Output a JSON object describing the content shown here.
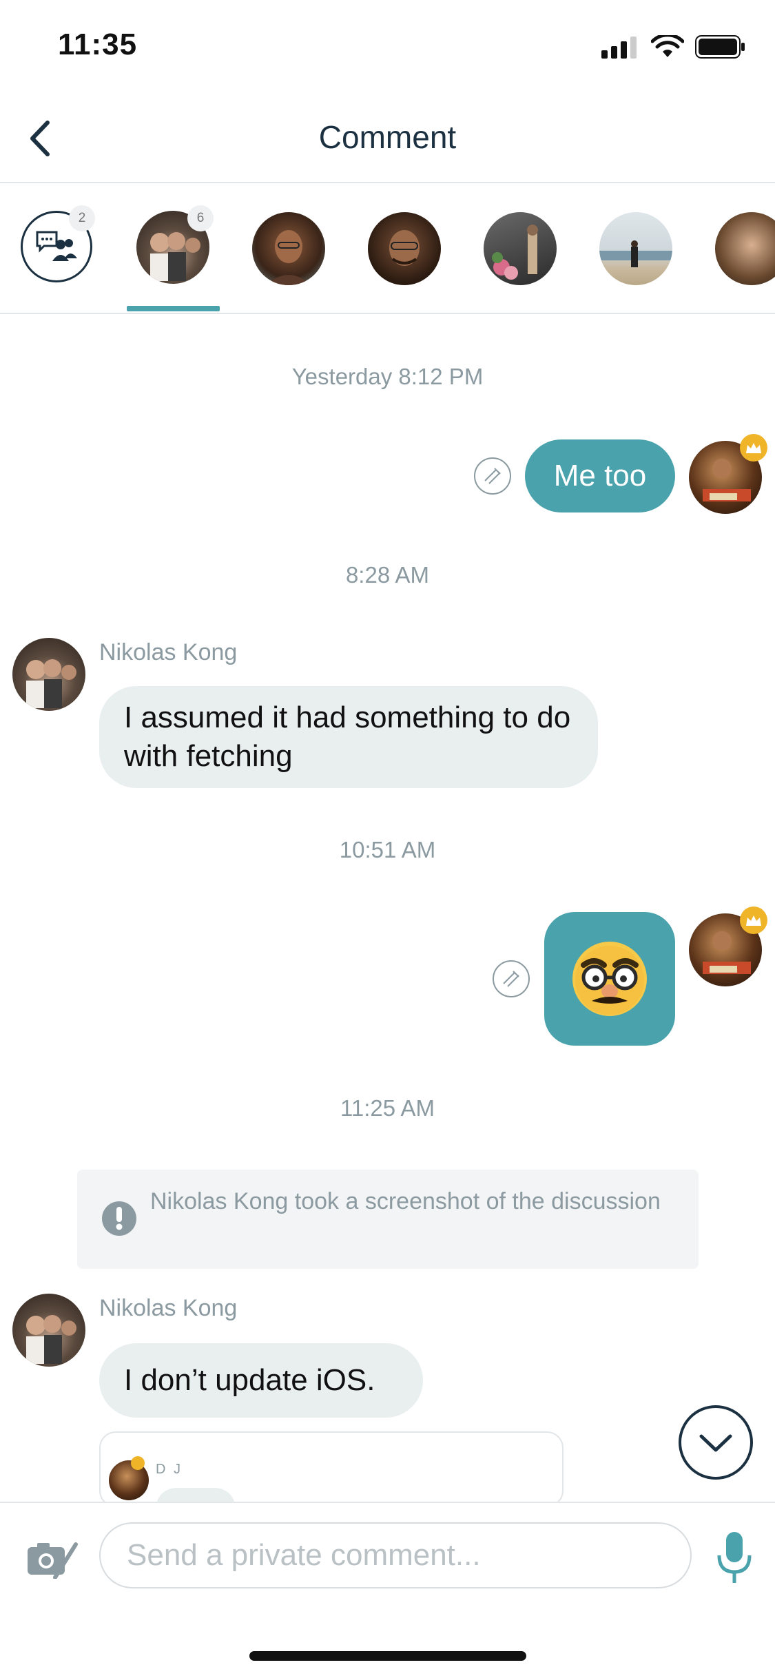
{
  "status": {
    "time": "11:35"
  },
  "header": {
    "title": "Comment"
  },
  "participants": {
    "group_badge": "2",
    "active_badge": "6"
  },
  "messages": {
    "ts1": "Yesterday 8:12 PM",
    "out1": "Me too",
    "ts2": "8:28 AM",
    "sender1": "Nikolas Kong",
    "in1": "I assumed it had something to do with fetching",
    "ts3": "10:51 AM",
    "ts4": "11:25 AM",
    "notice": "Nikolas Kong took a screenshot of the discussion",
    "sender2": "Nikolas Kong",
    "in2": "I don’t update iOS.",
    "quoted_sender": "D J"
  },
  "composer": {
    "placeholder": "Send a private comment..."
  },
  "colors": {
    "accent": "#4aa3ac",
    "navy": "#1b3040",
    "gold": "#f0b429"
  }
}
